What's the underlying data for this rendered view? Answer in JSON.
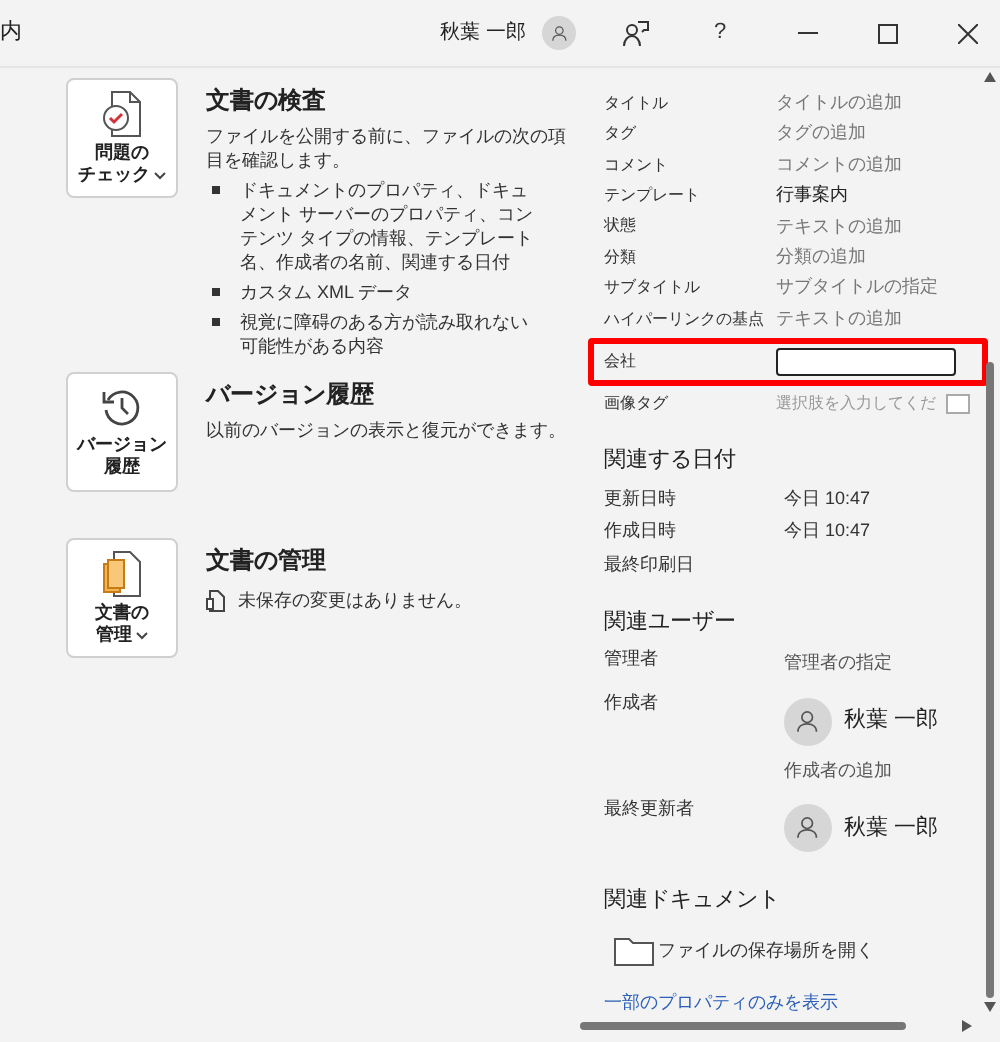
{
  "titlebar": {
    "title": "内",
    "user": "秋葉 一郎",
    "buttons": [
      "?"
    ]
  },
  "sections": [
    {
      "kind": "inspect",
      "button": [
        "問題の",
        "チェック"
      ],
      "has_dropdown": true,
      "title": "文書の検査",
      "description": "ファイルを公開する前に、ファイルの次の項目を確認します。",
      "bullets": [
        "ドキュメントのプロパティ、ドキュメント サーバーのプロパティ、コンテンツ タイプの情報、テンプレート名、作成者の名前、関連する日付",
        "カスタム XML データ",
        "視覚に障碍のある方が読み取れない可能性がある内容"
      ]
    },
    {
      "kind": "history",
      "button": [
        "バージョン",
        "履歴"
      ],
      "has_dropdown": false,
      "title": "バージョン履歴",
      "description": "以前のバージョンの表示と復元ができます。"
    },
    {
      "kind": "manage",
      "button": [
        "文書の",
        "管理"
      ],
      "has_dropdown": true,
      "title": "文書の管理",
      "status": "未保存の変更はありません。"
    }
  ],
  "properties": [
    {
      "label": "タイトル",
      "value": "タイトルの追加",
      "kind": "hint",
      "highlighted": false
    },
    {
      "label": "タグ",
      "value": "タグの追加",
      "kind": "hint",
      "highlighted": false
    },
    {
      "label": "コメント",
      "value": "コメントの追加",
      "kind": "hint",
      "highlighted": false
    },
    {
      "label": "テンプレート",
      "value": "行事案内",
      "kind": "value",
      "highlighted": false
    },
    {
      "label": "状態",
      "value": "テキストの追加",
      "kind": "hint",
      "highlighted": false
    },
    {
      "label": "分類",
      "value": "分類の追加",
      "kind": "hint",
      "highlighted": false
    },
    {
      "label": "サブタイトル",
      "value": "サブタイトルの指定",
      "kind": "hint",
      "highlighted": false
    },
    {
      "label": "ハイパーリンクの基点",
      "value": "テキストの追加",
      "kind": "hint",
      "highlighted": false
    },
    {
      "label": "会社",
      "kind": "input",
      "highlighted": true
    },
    {
      "label": "画像タグ",
      "value": "選択肢を入力してくだ",
      "kind": "picker",
      "highlighted": false
    }
  ],
  "dates": {
    "heading": "関連する日付",
    "rows": [
      {
        "label": "更新日時",
        "value": "今日 10:47"
      },
      {
        "label": "作成日時",
        "value": "今日 10:47"
      },
      {
        "label": "最終印刷日"
      }
    ]
  },
  "people": {
    "heading": "関連ユーザー",
    "rows": [
      {
        "label": "管理者",
        "value": "管理者の指定",
        "kind": "hint"
      },
      {
        "label": "作成者",
        "person": "秋葉 一郎",
        "add": "作成者の追加",
        "kind": "person"
      },
      {
        "label": "最終更新者",
        "person": "秋葉 一郎",
        "kind": "person"
      }
    ]
  },
  "documents": {
    "heading": "関連ドキュメント",
    "open_location": "ファイルの保存場所を開く"
  },
  "link": "一部のプロパティのみを表示"
}
